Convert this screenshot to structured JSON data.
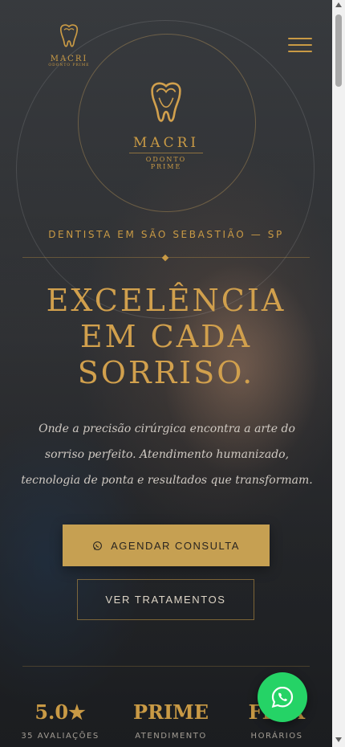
{
  "header": {
    "logo_small": {
      "brand": "MACRI",
      "sub": "ODONTO PRIME"
    },
    "menu_icon": "hamburger-menu-icon"
  },
  "hero": {
    "logo": {
      "brand": "MACRI",
      "sub": "ODONTO PRIME"
    },
    "eyebrow": "DENTISTA EM SÃO SEBASTIÃO — SP",
    "headline_lines": [
      "EXCELÊNCIA",
      "EM CADA",
      "SORRISO."
    ],
    "lead": "Onde a precisão cirúrgica encontra a arte do sorriso perfeito. Atendimento humanizado, tecnologia de ponta e resultados que transformam.",
    "primary_cta": {
      "icon": "whatsapp-icon",
      "label": "AGENDAR CONSULTA"
    },
    "secondary_cta": {
      "label": "VER TRATAMENTOS"
    }
  },
  "stats": [
    {
      "value": "5.0★",
      "label": "35 AVALIAÇÕES"
    },
    {
      "value": "PRIME",
      "label": "ATENDIMENTO"
    },
    {
      "value": "FLEX",
      "label": "HORÁRIOS"
    }
  ],
  "floating": {
    "whatsapp_icon": "whatsapp-icon"
  },
  "colors": {
    "gold": "#c99a45",
    "button_gold": "#c6a052",
    "whatsapp_green": "#25d366"
  }
}
